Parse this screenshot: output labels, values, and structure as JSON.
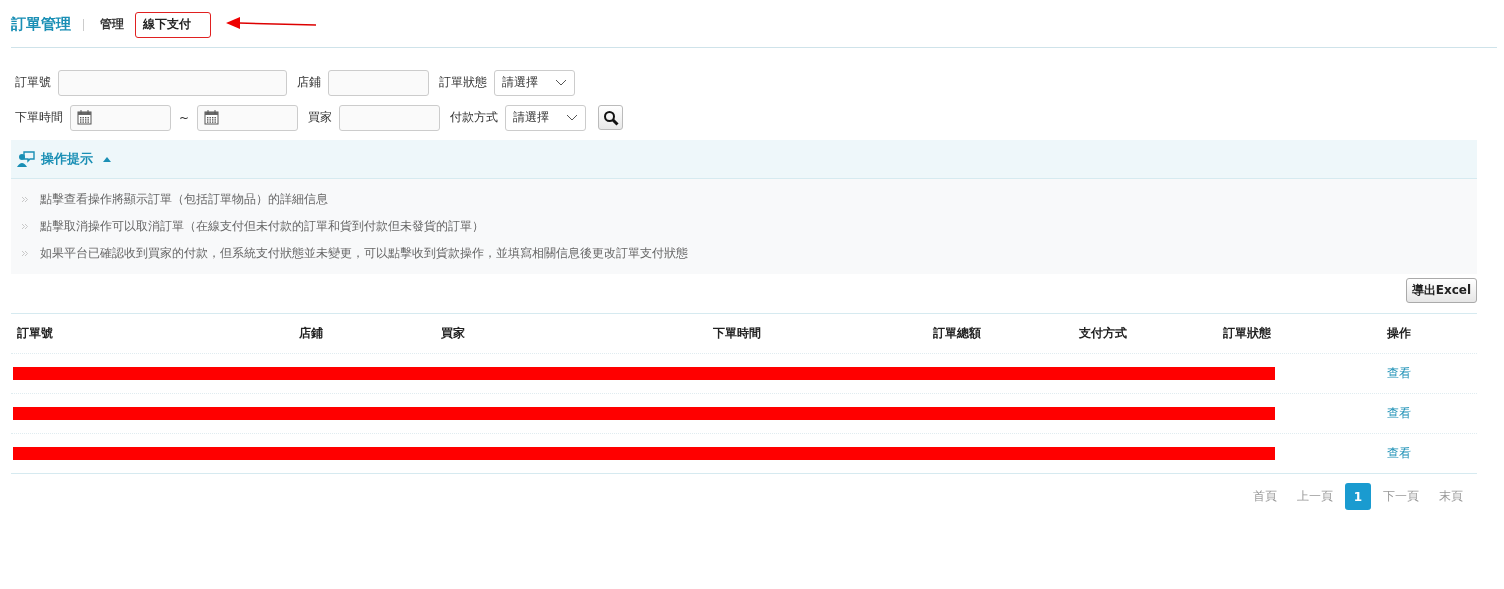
{
  "header": {
    "title": "訂單管理",
    "tabs": [
      {
        "label": "管理",
        "selected": false,
        "annotated": false
      },
      {
        "label": "線下支付",
        "selected": true,
        "annotated": true
      }
    ]
  },
  "filters": [
    {
      "label": "訂單號",
      "kind": "wide-text"
    },
    {
      "label": "店鋪",
      "kind": "text"
    },
    {
      "label": "訂單狀態",
      "kind": "select",
      "value": "請選擇"
    },
    {
      "label": "下單時間",
      "kind": "daterange",
      "separator": "~"
    },
    {
      "label": "買家",
      "kind": "text"
    },
    {
      "label": "付款方式",
      "kind": "select",
      "value": "請選擇"
    },
    {
      "kind": "search"
    }
  ],
  "tips": {
    "title": "操作提示",
    "expanded": true,
    "items": [
      "點擊查看操作將顯示訂單（包括訂單物品）的詳細信息",
      "點擊取消操作可以取消訂單（在線支付但未付款的訂單和貨到付款但未發貨的訂單）",
      "如果平台已確認收到買家的付款，但系統支付狀態並未變更，可以點擊收到貨款操作，並填寫相關信息後更改訂單支付狀態"
    ]
  },
  "export_button": "導出Excel",
  "table": {
    "columns": [
      "訂單號",
      "店鋪",
      "買家",
      "下單時間",
      "訂單總額",
      "支付方式",
      "訂單狀態",
      "操作"
    ],
    "rows": [
      {
        "redacted": true,
        "action": "查看"
      },
      {
        "redacted": true,
        "action": "查看"
      },
      {
        "redacted": true,
        "action": "查看"
      }
    ]
  },
  "pager": [
    {
      "label": "首頁",
      "selected": false
    },
    {
      "label": "上一頁",
      "selected": false
    },
    {
      "label": "1",
      "selected": true
    },
    {
      "label": "下一頁",
      "selected": false
    },
    {
      "label": "末頁",
      "selected": false
    }
  ]
}
